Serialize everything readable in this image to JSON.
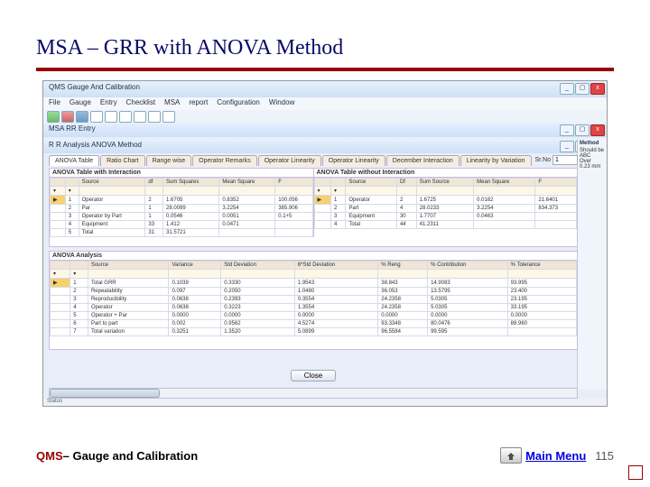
{
  "title": "MSA – GRR with ANOVA Method",
  "footer": {
    "qms": "QMS ",
    "subtitle": "– Gauge and Calibration",
    "main_menu": "Main Menu",
    "page": "115"
  },
  "app": {
    "main_title": "QMS  Gauge And Calibration",
    "sub_title": "MSA RR Entry",
    "sub2_title": "R R Analysis  ANOVA Method",
    "menubar": [
      "File",
      "Gauge",
      "Entry",
      "Checklist",
      "MSA",
      "report",
      "Configuration",
      "Window"
    ],
    "right_panel_title": "Method",
    "right_items": [
      "Should be",
      "ABC",
      "Over",
      "0.23 mm"
    ],
    "status": "Status"
  },
  "tabs": [
    "ANOVA Table",
    "Ratio Chart",
    "Range wise",
    "Operator Remarks",
    "Operator Linearity",
    "Operator Linearity",
    "December Interaction",
    "Linearity by Variation"
  ],
  "spinners": [
    {
      "label": "Sr.No",
      "value": "1"
    }
  ],
  "anova_inter": {
    "caption": "ANOVA Table with Interaction",
    "cols": [
      "",
      "",
      "Source",
      "df",
      "Sum Squares",
      "Mean Square",
      "F"
    ],
    "rows": [
      [
        "▶",
        "1",
        "Operator",
        "2",
        "1.6705",
        "0.8352",
        "100.056"
      ],
      [
        "",
        "2",
        "Par",
        "1",
        "28.0099",
        "3.2254",
        "385.906"
      ],
      [
        "",
        "3",
        "Operator by Part",
        "1",
        "0.0546",
        "0.0051",
        "0.1+5"
      ],
      [
        "",
        "4",
        "Equipment",
        "33",
        "1.412",
        "0.0471",
        ""
      ],
      [
        "",
        "5",
        "Total",
        "31",
        "31.5721",
        "",
        ""
      ]
    ]
  },
  "anova_nointer": {
    "caption": "ANOVA Table without Interaction",
    "cols": [
      "",
      "",
      "Source",
      "Df",
      "Sum Source",
      "Mean Square",
      "F"
    ],
    "rows": [
      [
        "▶",
        "1",
        "Operator",
        "2",
        "1.6725",
        "0.0162",
        "21.6401"
      ],
      [
        "",
        "2",
        "Part",
        "4",
        "28.0233",
        "3.2254",
        "834.373"
      ],
      [
        "",
        "3",
        "Equipment",
        "30",
        "1.7707",
        "0.0463",
        ""
      ],
      [
        "",
        "4",
        "Total",
        "44",
        "41.2311",
        "",
        ""
      ]
    ]
  },
  "anova_analysis": {
    "caption": "ANOVA Analysis",
    "cols": [
      "",
      "",
      "Source",
      "Variance",
      "Std Deviation",
      "6*Std Deviation",
      "% Reng",
      "% Contribution",
      "% Tolerance"
    ],
    "rows": [
      [
        "▶",
        "1",
        "Total GRR",
        "0.1039",
        "0.3330",
        "1.9543",
        "38.843",
        "14.9083",
        "93.995"
      ],
      [
        "",
        "2",
        "Repeatability",
        "0.097",
        "0.2050",
        "1.0480",
        "36.053",
        "13.5795",
        "23.400"
      ],
      [
        "",
        "3",
        "Reproducibility",
        "0.0638",
        "0.2393",
        "0.3554",
        "24.2358",
        "5.0305",
        "23.195"
      ],
      [
        "",
        "4",
        "Operator",
        "0.0638",
        "0.3223",
        "1.3554",
        "24.2358",
        "5.0305",
        "33.195"
      ],
      [
        "",
        "5",
        "Operator + Par",
        "0.0000",
        "0.0000",
        "0.0000",
        "0.0000",
        "0.0000",
        "0.0000"
      ],
      [
        "",
        "6",
        "Part to part",
        "0.002",
        "0.9562",
        "4.5274",
        "93.3348",
        "80.0476",
        "88.960"
      ],
      [
        "",
        "7",
        "Total variation",
        "0.3251",
        "1.3520",
        "5.0899",
        "96.5584",
        "99.595",
        ""
      ]
    ]
  },
  "close_label": "Close"
}
